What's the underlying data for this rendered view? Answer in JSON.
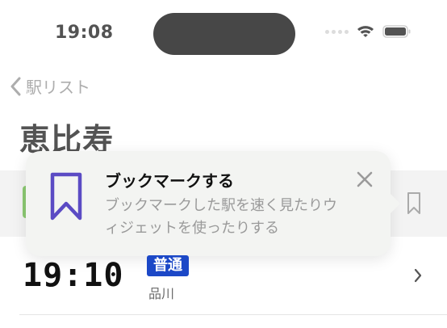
{
  "status_bar": {
    "time": "19:08",
    "icons": [
      "cellular-dots-icon",
      "wifi-icon",
      "battery-icon"
    ]
  },
  "nav": {
    "back_label": "駅リスト",
    "back_icon": "chevron-left-icon"
  },
  "station": {
    "title": "恵比寿"
  },
  "tip": {
    "title": "ブックマークする",
    "message": "ブックマークした駅を速く見たりウィジェットを使ったりする",
    "icon": "bookmark-icon",
    "close_icon": "close-icon",
    "icon_color": "#5b4bc4"
  },
  "departure": {
    "time": "19:10",
    "type": "普通",
    "type_color": "#1c48c7",
    "destination": "品川"
  },
  "row_above": {
    "line_color": "#5fb43c",
    "bookmark_icon": "bookmark-outline-icon"
  }
}
